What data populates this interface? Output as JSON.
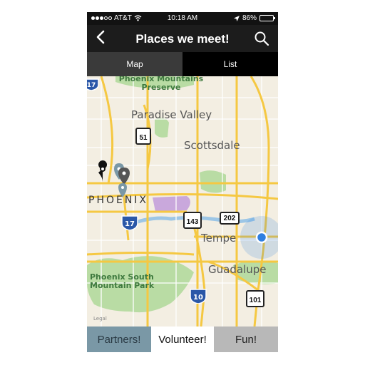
{
  "status": {
    "carrier": "AT&T",
    "time": "10:18 AM",
    "battery": "86%",
    "battery_level": 0.86
  },
  "nav": {
    "title": "Places we meet!",
    "back_icon": "chevron-left-icon",
    "search_icon": "search-icon"
  },
  "segments": {
    "map": "Map",
    "list": "List",
    "selected": "Map"
  },
  "map": {
    "labels": {
      "park_north": "Phoenix Mountains Preserve",
      "paradise_valley": "Paradise Valley",
      "scottsdale": "Scottsdale",
      "phoenix": "PHOENIX",
      "tempe": "Tempe",
      "guadalupe": "Guadalupe",
      "park_south": "Phoenix South Mountain Park",
      "legal": "Legal"
    },
    "shields": {
      "i17_top": "17",
      "sr51": "51",
      "i17": "17",
      "sr143": "143",
      "loop202": "202",
      "i10": "10",
      "loop101": "101"
    },
    "colors": {
      "land": "#f3eee2",
      "park": "#b9dca4",
      "highway": "#f5c842",
      "water": "#9cc6e6",
      "location": "#2f7fe0"
    }
  },
  "tabs": {
    "partners": "Partners!",
    "volunteer": "Volunteer!",
    "fun": "Fun!"
  }
}
